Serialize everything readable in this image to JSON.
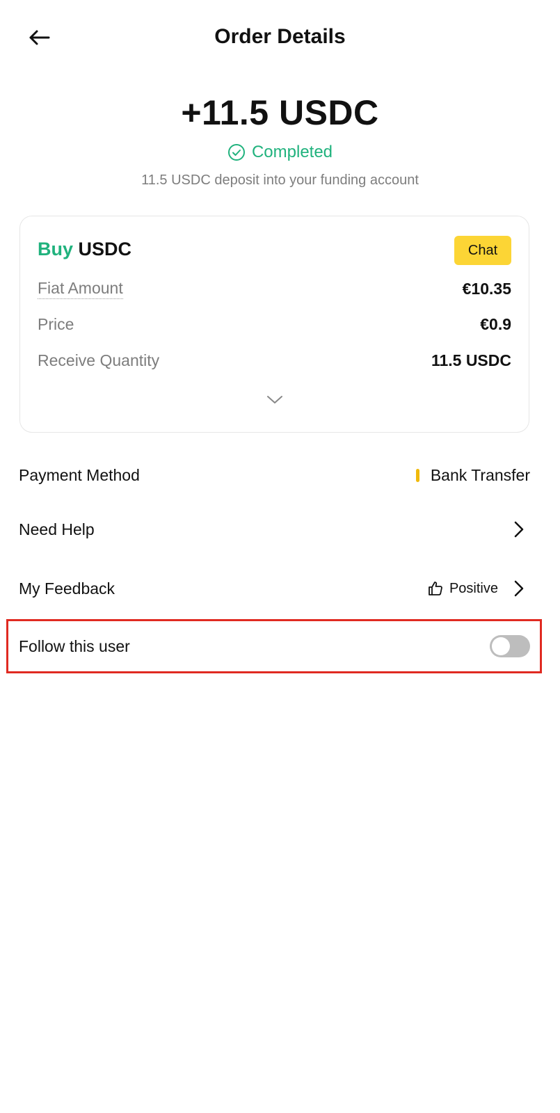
{
  "header": {
    "title": "Order Details",
    "back_icon": "arrow-left-icon"
  },
  "summary": {
    "amount": "+11.5 USDC",
    "status": "Completed",
    "status_color": "#20b27d",
    "subtitle": "11.5 USDC deposit into your funding account"
  },
  "card": {
    "side": "Buy",
    "asset": "USDC",
    "chat_label": "Chat",
    "rows": [
      {
        "label": "Fiat Amount",
        "value": "€10.35"
      },
      {
        "label": "Price",
        "value": "€0.9"
      },
      {
        "label": "Receive Quantity",
        "value": "11.5 USDC"
      }
    ],
    "expand_icon": "chevron-down-icon"
  },
  "list": {
    "payment_method": {
      "label": "Payment Method",
      "value": "Bank Transfer"
    },
    "need_help": {
      "label": "Need Help"
    },
    "feedback": {
      "label": "My Feedback",
      "value": "Positive"
    },
    "follow": {
      "label": "Follow this user",
      "enabled": false
    }
  },
  "colors": {
    "accent_yellow": "#fcd535",
    "success_green": "#20b27d",
    "highlight_red": "#e02a21"
  }
}
